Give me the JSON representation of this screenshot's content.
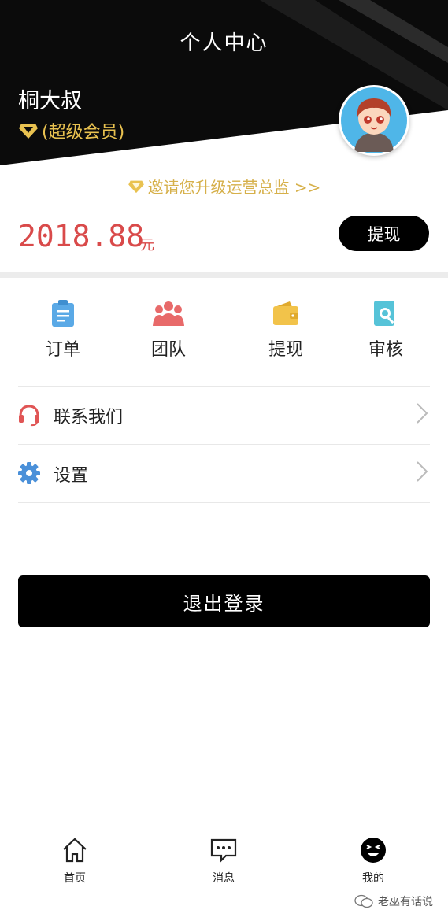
{
  "header": {
    "title": "个人中心",
    "username": "桐大叔",
    "member_level": "(超级会员)"
  },
  "invite": {
    "text": "邀请您升级运营总监 >>"
  },
  "balance": {
    "amount": "2018.88",
    "currency": "元",
    "withdraw_label": "提现"
  },
  "quick_actions": [
    {
      "label": "订单",
      "icon": "clipboard-icon",
      "color": "#5aa9e6"
    },
    {
      "label": "团队",
      "icon": "team-icon",
      "color": "#e86a6a"
    },
    {
      "label": "提现",
      "icon": "wallet-icon",
      "color": "#f2c34a"
    },
    {
      "label": "审核",
      "icon": "review-icon",
      "color": "#56c3d8"
    }
  ],
  "menu": [
    {
      "label": "联系我们",
      "icon": "headset-icon",
      "color": "#e05555"
    },
    {
      "label": "设置",
      "icon": "gear-icon",
      "color": "#4a90d9"
    }
  ],
  "logout_label": "退出登录",
  "tabbar": [
    {
      "label": "首页",
      "icon": "home-icon"
    },
    {
      "label": "消息",
      "icon": "message-icon"
    },
    {
      "label": "我的",
      "icon": "smile-icon",
      "active": true
    }
  ],
  "watermark": "老巫有话说",
  "colors": {
    "accent_red": "#d94a4a",
    "gold": "#d6b04a",
    "black": "#000000"
  }
}
